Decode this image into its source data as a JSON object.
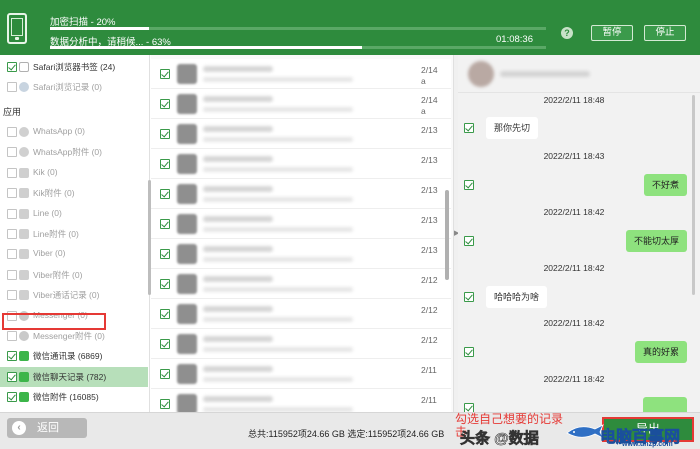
{
  "header": {
    "title": "",
    "scan_label": "加密扫描 - 20%",
    "scan_progress": 0.2,
    "analyze_label": "数据分析中，请稍候... - 63%",
    "analyze_progress": 0.63,
    "elapsed_time": "01:08:36",
    "help_symbol": "?",
    "pause_label": "暂停",
    "stop_label": "停止"
  },
  "sidebar": {
    "items_top": [
      {
        "label": "Safari浏览器书签 (24)",
        "checked": true,
        "icon": "bookmark-icon",
        "dark": true
      },
      {
        "label": "Safari浏览记录 (0)",
        "checked": false,
        "icon": "safari-icon",
        "dark": false
      }
    ],
    "section_label": "应用",
    "items": [
      {
        "label": "WhatsApp (0)",
        "checked": false,
        "icon": "whatsapp-icon",
        "dark": false
      },
      {
        "label": "WhatsApp附件 (0)",
        "checked": false,
        "icon": "whatsapp-icon",
        "dark": false
      },
      {
        "label": "Kik (0)",
        "checked": false,
        "icon": "kik-icon",
        "dark": false
      },
      {
        "label": "Kik附件 (0)",
        "checked": false,
        "icon": "kik-icon",
        "dark": false
      },
      {
        "label": "Line (0)",
        "checked": false,
        "icon": "line-icon",
        "dark": false
      },
      {
        "label": "Line附件 (0)",
        "checked": false,
        "icon": "line-icon",
        "dark": false
      },
      {
        "label": "Viber (0)",
        "checked": false,
        "icon": "viber-icon",
        "dark": false
      },
      {
        "label": "Viber附件 (0)",
        "checked": false,
        "icon": "viber-icon",
        "dark": false
      },
      {
        "label": "Viber通话记录 (0)",
        "checked": false,
        "icon": "viber-icon",
        "dark": false
      },
      {
        "label": "Messenger (0)",
        "checked": false,
        "icon": "messenger-icon",
        "dark": false
      },
      {
        "label": "Messenger附件 (0)",
        "checked": false,
        "icon": "messenger-icon",
        "dark": false
      },
      {
        "label": "微信通讯录 (6869)",
        "checked": true,
        "icon": "wechat-icon",
        "dark": true
      },
      {
        "label": "微信聊天记录 (782)",
        "checked": true,
        "icon": "wechat-icon",
        "dark": true,
        "selected": true
      },
      {
        "label": "微信附件 (16085)",
        "checked": true,
        "icon": "wechat-icon",
        "dark": true
      }
    ]
  },
  "list": {
    "rows": [
      {
        "date": "2/14",
        "date2": "a"
      },
      {
        "date": "2/14",
        "date2": "a"
      },
      {
        "date": "2/13",
        "date2": ""
      },
      {
        "date": "2/13",
        "date2": ""
      },
      {
        "date": "2/13",
        "date2": ""
      },
      {
        "date": "2/13",
        "date2": ""
      },
      {
        "date": "2/13",
        "date2": ""
      },
      {
        "date": "2/12",
        "date2": ""
      },
      {
        "date": "2/12",
        "date2": ""
      },
      {
        "date": "2/12",
        "date2": ""
      },
      {
        "date": "2/11",
        "date2": ""
      },
      {
        "date": "2/11",
        "date2": ""
      }
    ]
  },
  "chat": {
    "messages": [
      {
        "time": "2022/2/11 18:48",
        "text": "那你先切",
        "dir": "in"
      },
      {
        "time": "2022/2/11 18:43",
        "text": "不好煮",
        "dir": "out"
      },
      {
        "time": "2022/2/11 18:42",
        "text": "不能切太厚",
        "dir": "out"
      },
      {
        "time": "2022/2/11 18:42",
        "text": "哈哈哈为啥",
        "dir": "in"
      },
      {
        "time": "2022/2/11 18:42",
        "text": "真的好累",
        "dir": "out"
      },
      {
        "time": "2022/2/11 18:42",
        "text": "",
        "dir": "out"
      }
    ]
  },
  "footer": {
    "back_icon": "‹",
    "back_label": "返回",
    "summary": "总共:115952项24.66 GB 选定:115952项24.66 GB",
    "annotation_line1": "勾选自己想要的记录",
    "annotation_line2": "击",
    "export_label": "导出",
    "watermark1": "头条 @数据",
    "watermark2": "电脑百事网",
    "watermark3": "www.dnzp.com"
  },
  "colors": {
    "header_green": "#2e8b3d",
    "bubble_green": "#8ee27e",
    "highlight_red": "#e53935"
  }
}
